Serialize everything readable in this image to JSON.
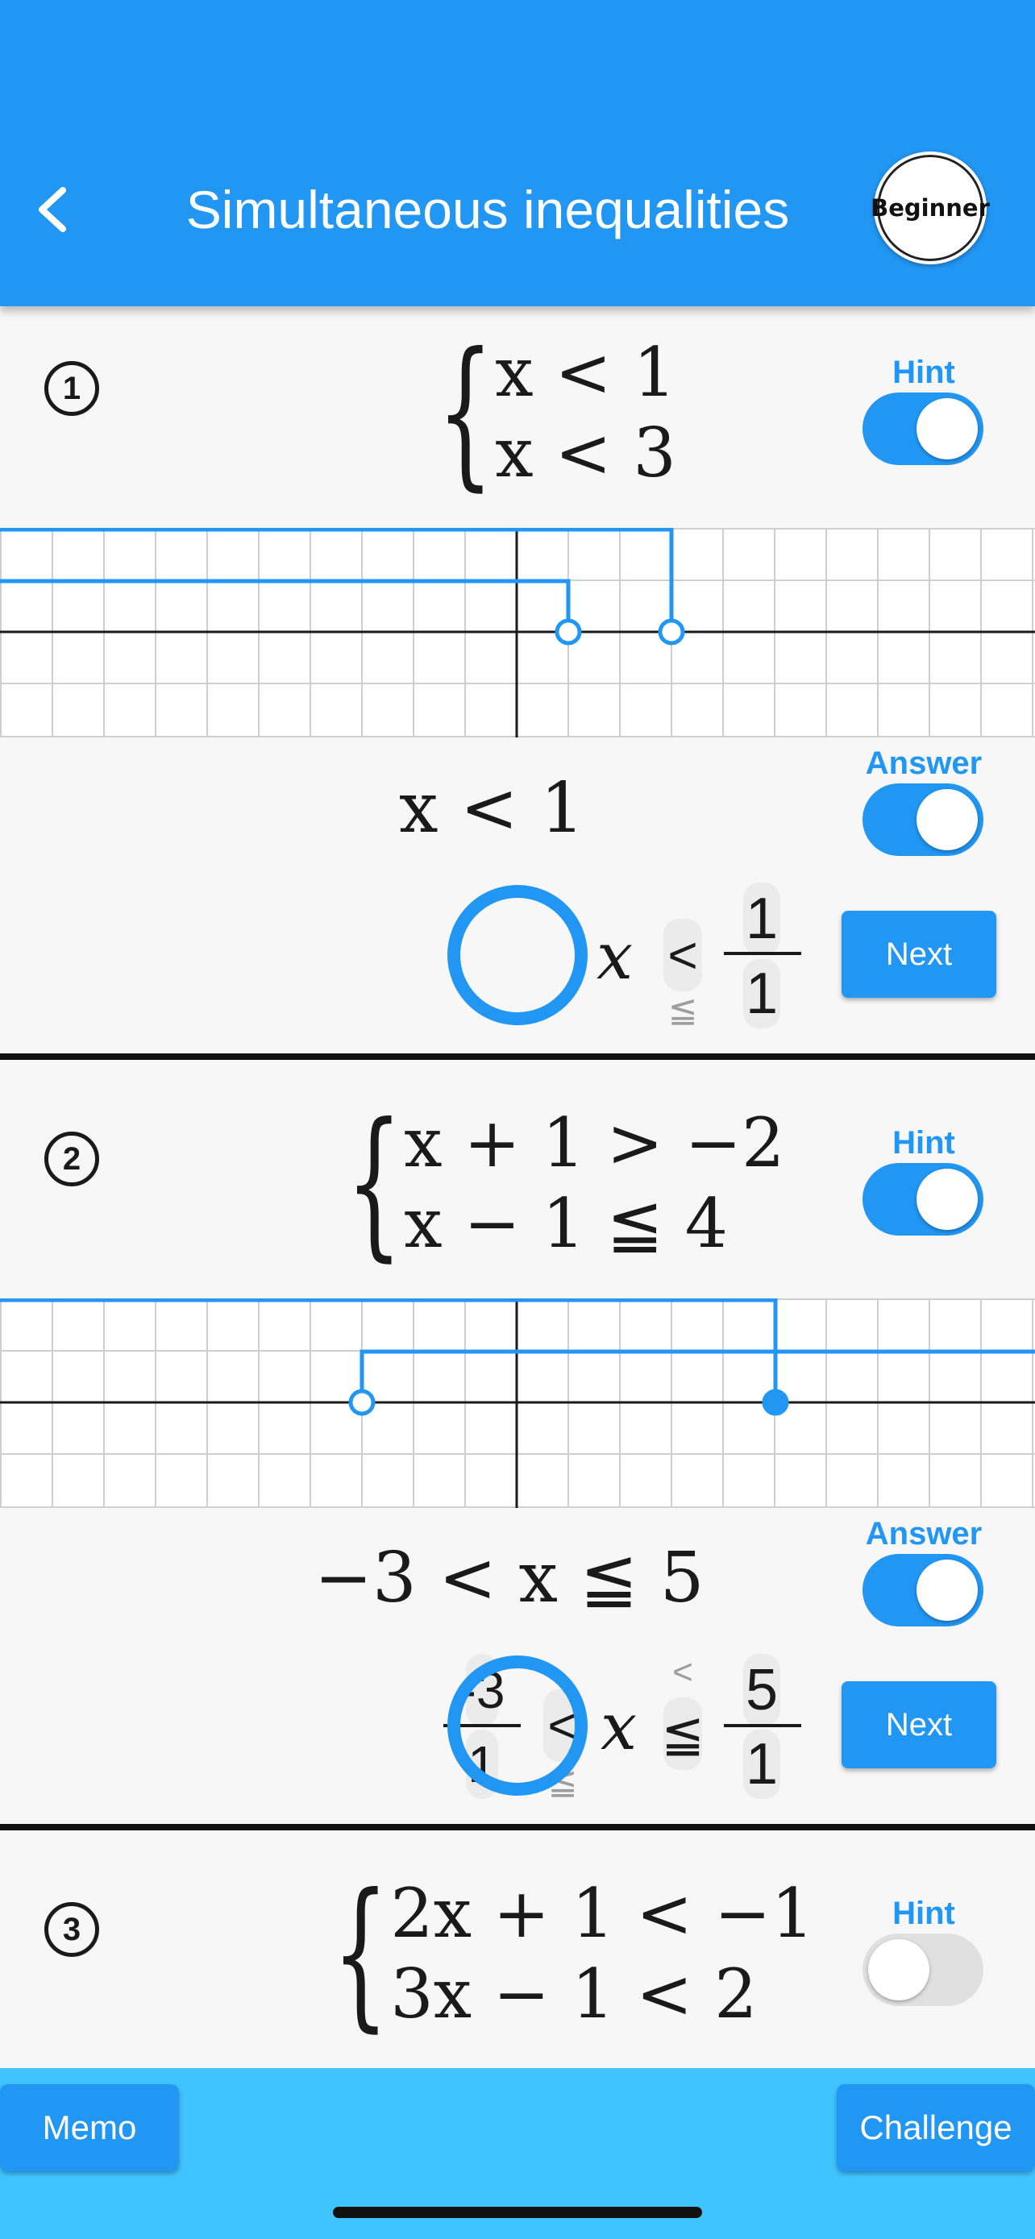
{
  "header": {
    "title": "Simultaneous inequalities",
    "level": "Beginner",
    "color": "#2196f3"
  },
  "toggle_labels": {
    "hint": "Hint",
    "answer": "Answer"
  },
  "problems": [
    {
      "number": "1",
      "equations": [
        "x < 1",
        "x < 3"
      ],
      "hint_on": true,
      "answer_on": true,
      "answer_text": "x < 1",
      "input": {
        "left_value": null,
        "left_op": null,
        "var": "x",
        "right_op": "<",
        "right_op_alt": "≦",
        "right_num": "1",
        "right_den": "1"
      },
      "next_label": "Next"
    },
    {
      "number": "2",
      "equations": [
        "x + 1 > −2",
        "x − 1 ≦ 4"
      ],
      "hint_on": true,
      "answer_on": true,
      "answer_text": "−3 < x ≦ 5",
      "input": {
        "left_num": "-3",
        "left_den": "1",
        "left_op": "<",
        "left_op_alt": "≦",
        "var": "x",
        "right_op_alt": "<",
        "right_op": "≦",
        "right_num": "5",
        "right_den": "1"
      },
      "next_label": "Next"
    },
    {
      "number": "3",
      "equations": [
        "2x + 1 < −1",
        "3x − 1 < 2"
      ],
      "hint_on": false
    }
  ],
  "bottom_bar": {
    "memo_label": "Memo",
    "challenge_label": "Challenge",
    "color": "#40c4ff"
  },
  "icons": {
    "back": "chevron-left-icon"
  }
}
